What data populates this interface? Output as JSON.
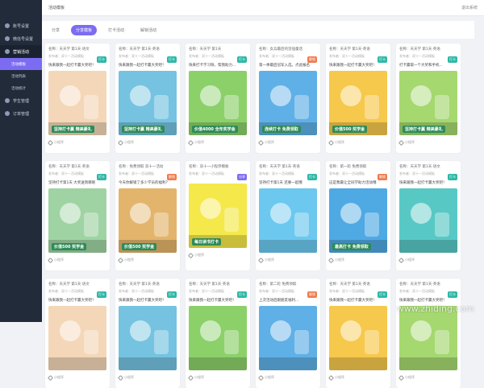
{
  "topbar": {
    "title": "活动模板",
    "logout": "退出系统"
  },
  "sidebar": {
    "items": [
      {
        "label": "账号设置",
        "icon": "user-icon"
      },
      {
        "label": "微信号设置",
        "icon": "wechat-icon"
      },
      {
        "label": "营销活动",
        "icon": "megaphone-icon"
      },
      {
        "label": "活动模板",
        "sub": true,
        "current": true
      },
      {
        "label": "活动列表",
        "sub": true
      },
      {
        "label": "活动统计",
        "sub": true
      },
      {
        "label": "学生管理",
        "icon": "student-icon"
      },
      {
        "label": "订单管理",
        "icon": "order-icon"
      }
    ]
  },
  "tabs": [
    "分享",
    "分享模板",
    "打卡活动",
    "解锁活动"
  ],
  "cards": [
    {
      "name": "名称：天天学 第1天·语文",
      "author": "发布者：双十一活动模板",
      "badge": "打卡",
      "badge_color": "#2cb7a6",
      "desc": "快来跟我一起打卡赢大奖吧！",
      "color": "#f3d7b8",
      "promo": "坚持打卡赢 精美豪礼"
    },
    {
      "name": "名称：天天学 第1天·英语",
      "author": "发布者：双十一活动模板",
      "badge": "打卡",
      "badge_color": "#2cb7a6",
      "desc": "快来跟我一起打卡赢大奖吧！",
      "color": "#75c3e0",
      "promo": "坚持打卡赢 精美豪礼"
    },
    {
      "name": "名称：天天学 第1天",
      "author": "发布者：双十一活动模板",
      "badge": "打卡",
      "badge_color": "#2cb7a6",
      "desc": "快来打卡学习呀，帮我助力...",
      "color": "#8cd06a",
      "promo": "价值4000 全年奖学金"
    },
    {
      "name": "名称：女兵最后的坚强童话",
      "author": "发布者：双十一活动模板",
      "badge": "解锁",
      "badge_color": "#ef7b4d",
      "desc": "第一季最后冠军入选，点此报名",
      "color": "#5fb0e6",
      "promo": "连续打卡 免费领取"
    },
    {
      "name": "名称：天天学 第1天·英语",
      "author": "发布者：双十一活动模板",
      "badge": "打卡",
      "badge_color": "#2cb7a6",
      "desc": "快来跟我一起打卡赢大奖吧！",
      "color": "#f6c84c",
      "promo": "价值500 奖学金"
    },
    {
      "name": "名称：天天学 第1天·英语",
      "author": "发布者：双十一活动模板",
      "badge": "打卡",
      "badge_color": "#2cb7a6",
      "desc": "打卡赢取一个大奖和手机...",
      "color": "#a5d86f",
      "promo": "坚持打卡赢 精美豪礼"
    },
    {
      "name": "名称：天天学 第1天·英语",
      "author": "发布者：双十一活动模板",
      "badge": "打卡",
      "badge_color": "#2cb7a6",
      "desc": "坚持打卡第1天 大奖送到哪呢",
      "color": "#9fd3a3",
      "promo": "价值500 奖学金"
    },
    {
      "name": "名称：免费领取 双十一活动",
      "author": "发布者：双十一活动模板",
      "badge": "解锁",
      "badge_color": "#ef7b4d",
      "desc": "今天你解锁了多少学员的福利？",
      "color": "#e3b46b",
      "promo": "价值500 奖学金"
    },
    {
      "name": "名称：双十一小程序模板",
      "author": "发布者：双十一活动模板",
      "badge": "分享",
      "badge_color": "#7c6cf2",
      "desc": "",
      "color": "#f5e84a",
      "promo": "每日读书打卡"
    },
    {
      "name": "名称：天天学 第1天·英语",
      "author": "发布者：双十一活动模板",
      "badge": "打卡",
      "badge_color": "#2cb7a6",
      "desc": "坚持打卡第1天 还要一起哦",
      "color": "#6cc8ef",
      "promo": ""
    },
    {
      "name": "名称：第一轮 免费领取",
      "author": "发布者：双十一活动模板",
      "badge": "解锁",
      "badge_color": "#ef7b4d",
      "desc": "这是我最让全同学助力活动哦",
      "color": "#4fa9e3",
      "promo": "最高打卡 免费领取"
    },
    {
      "name": "名称：天天学 第1天·语文",
      "author": "发布者：双十一活动模板",
      "badge": "打卡",
      "badge_color": "#2cb7a6",
      "desc": "快来跟我一起打卡赢大奖吧！",
      "color": "#58c8c5",
      "promo": ""
    },
    {
      "name": "名称：天天学 第1天·语文",
      "author": "发布者：双十一活动模板",
      "badge": "打卡",
      "badge_color": "#2cb7a6",
      "desc": "快来跟我一起打卡赢大奖吧！",
      "color": "#f3d7b8",
      "promo": ""
    },
    {
      "name": "名称：天天学 第1天·英语",
      "author": "发布者：双十一活动模板",
      "badge": "打卡",
      "badge_color": "#2cb7a6",
      "desc": "快来跟我一起打卡赢大奖吧！",
      "color": "#75c3e0",
      "promo": ""
    },
    {
      "name": "名称：天天学 第1天·英语",
      "author": "发布者：双十一活动模板",
      "badge": "打卡",
      "badge_color": "#2cb7a6",
      "desc": "快来跟我一起打卡赢大奖吧！",
      "color": "#8cd06a",
      "promo": ""
    },
    {
      "name": "名称：第二轮 免费领取",
      "author": "发布者：双十一活动模板",
      "badge": "解锁",
      "badge_color": "#ef7b4d",
      "desc": "上次活动后跟朋友福利...",
      "color": "#5fb0e6",
      "promo": ""
    },
    {
      "name": "名称：天天学 第1天·英语",
      "author": "发布者：双十一活动模板",
      "badge": "打卡",
      "badge_color": "#2cb7a6",
      "desc": "快来跟我一起打卡赢大奖吧！",
      "color": "#f6c84c",
      "promo": ""
    },
    {
      "name": "名称：天天学 第1天·英语",
      "author": "发布者：双十一活动模板",
      "badge": "打卡",
      "badge_color": "#2cb7a6",
      "desc": "快来跟我一起打卡赢大奖吧！",
      "color": "#a5d86f",
      "promo": ""
    }
  ],
  "card_footer": "小程序",
  "watermark": "www.zhiding.com"
}
